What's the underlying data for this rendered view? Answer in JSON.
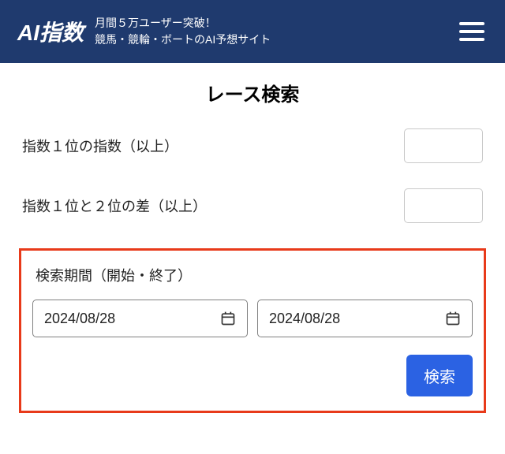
{
  "header": {
    "logo": "AI指数",
    "tagline_line1": "月間５万ユーザー突破！",
    "tagline_line2": "競馬・競輪・ボートのAI予想サイト"
  },
  "page": {
    "title": "レース検索"
  },
  "form": {
    "index1_label": "指数１位の指数（以上）",
    "index1_value": "",
    "diff_label": "指数１位と２位の差（以上）",
    "diff_value": "",
    "period_label": "検索期間（開始・終了）",
    "date_start": "2024/08/28",
    "date_end": "2024/08/28",
    "search_button": "検索"
  }
}
